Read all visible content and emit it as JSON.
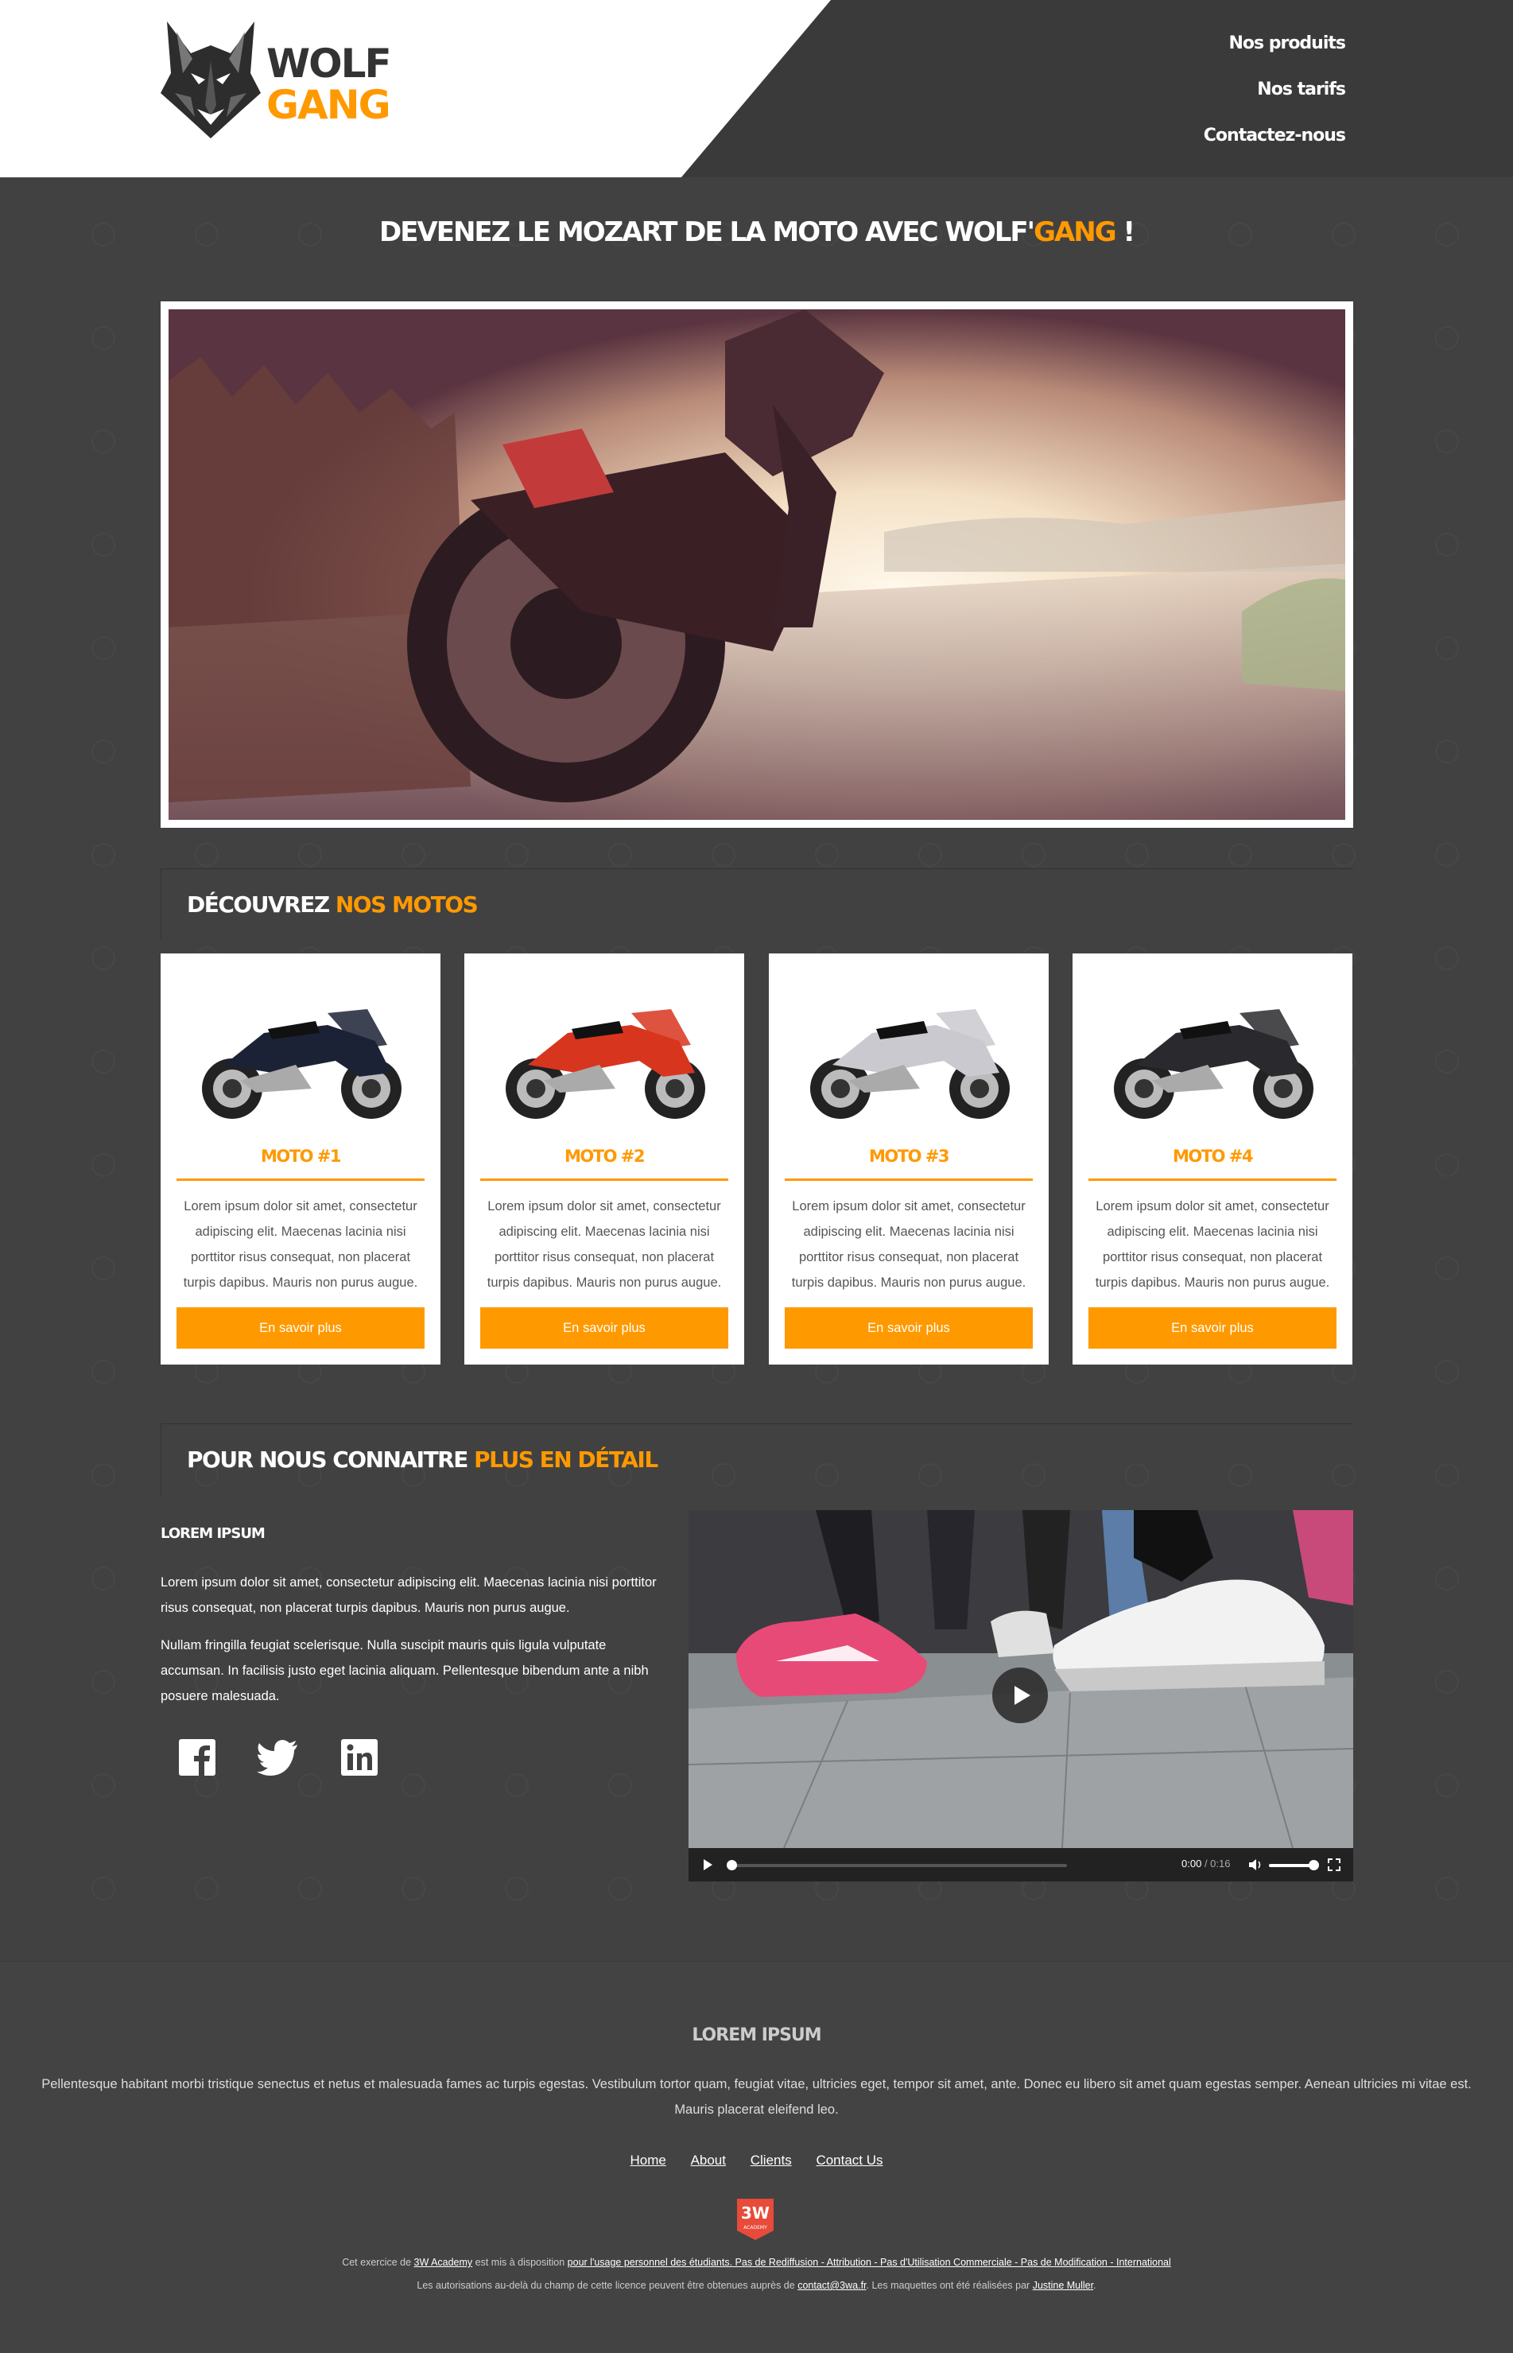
{
  "header": {
    "logo_top": "WOLF",
    "logo_bottom": "GANG",
    "nav": [
      "Nos produits",
      "Nos tarifs",
      "Contactez-nous"
    ]
  },
  "hero": {
    "title_main": "DEVENEZ LE MOZART DE LA MOTO AVEC WOLF'",
    "title_accent": "GANG",
    "title_end": " !"
  },
  "products": {
    "heading_main": "DÉCOUVREZ ",
    "heading_accent": "NOS MOTOS",
    "items": [
      {
        "title": "MOTO #1",
        "text": "Lorem ipsum dolor sit amet, consectetur adipiscing elit. Maecenas lacinia nisi porttitor risus consequat, non placerat turpis dapibus. Mauris non purus augue.",
        "button": "En savoir plus",
        "color": "#1c2236"
      },
      {
        "title": "MOTO #2",
        "text": "Lorem ipsum dolor sit amet, consectetur adipiscing elit. Maecenas lacinia nisi porttitor risus consequat, non placerat turpis dapibus. Mauris non purus augue.",
        "button": "En savoir plus",
        "color": "#d8351f"
      },
      {
        "title": "MOTO #3",
        "text": "Lorem ipsum dolor sit amet, consectetur adipiscing elit. Maecenas lacinia nisi porttitor risus consequat, non placerat turpis dapibus. Mauris non purus augue.",
        "button": "En savoir plus",
        "color": "#c9c9cf"
      },
      {
        "title": "MOTO #4",
        "text": "Lorem ipsum dolor sit amet, consectetur adipiscing elit. Maecenas lacinia nisi porttitor risus consequat, non placerat turpis dapibus. Mauris non purus augue.",
        "button": "En savoir plus",
        "color": "#2a2a2e"
      }
    ]
  },
  "about": {
    "heading_main": "POUR NOUS CONNAITRE ",
    "heading_accent": "PLUS EN DÉTAIL",
    "subtitle": "LOREM IPSUM",
    "p1": "Lorem ipsum dolor sit amet, consectetur adipiscing elit. Maecenas lacinia nisi porttitor risus consequat, non placerat turpis dapibus. Mauris non purus augue.",
    "p2": "Nullam fringilla feugiat scelerisque. Nulla suscipit mauris quis ligula vulputate accumsan. In facilisis justo eget lacinia aliquam. Pellentesque bibendum ante a nibh posuere malesuada.",
    "social": [
      "facebook-icon",
      "twitter-icon",
      "linkedin-icon"
    ],
    "video": {
      "current": "0:00",
      "duration": "/ 0:16"
    }
  },
  "footer": {
    "title": "LOREM IPSUM",
    "text": "Pellentesque habitant morbi tristique senectus et netus et malesuada fames ac turpis egestas. Vestibulum tortor quam, feugiat vitae, ultricies eget, tempor sit amet, ante. Donec eu libero sit amet quam egestas semper. Aenean ultricies mi vitae est. Mauris placerat eleifend leo.",
    "links": [
      "Home",
      "About",
      "Clients",
      "Contact Us"
    ],
    "badge_top": "3W",
    "badge_bottom": "ACADEMY",
    "license_prefix": "Cet exercice de ",
    "license_academy": "3W Academy",
    "license_middle": " est mis à disposition ",
    "license_terms": "pour l'usage personnel des étudiants. Pas de Rediffusion - Attribution - Pas d'Utilisation Commerciale - Pas de Modification - International",
    "license2_prefix": "Les autorisations au-delà du champ de cette licence peuvent être obtenues auprès de ",
    "license2_email": "contact@3wa.fr",
    "license2_middle": ". Les maquettes ont été réalisées par ",
    "license2_author": "Justine Muller",
    "license2_end": "."
  }
}
